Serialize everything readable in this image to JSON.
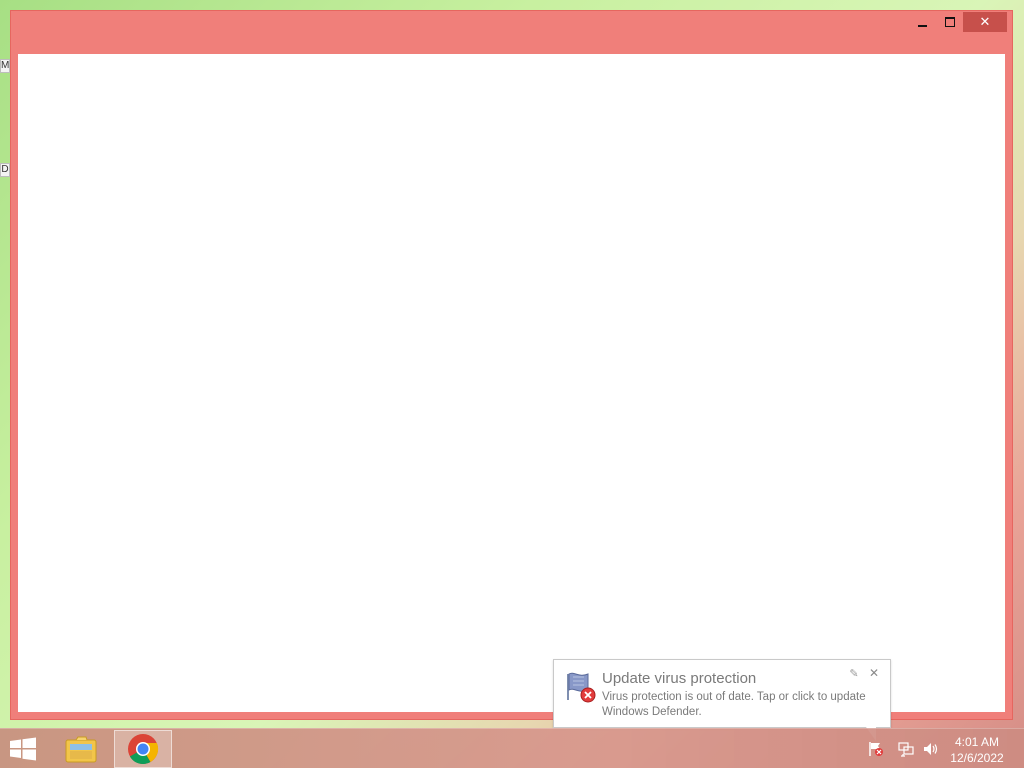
{
  "desktop": {
    "icons": [
      {
        "name": "M"
      },
      {
        "name": "D"
      }
    ]
  },
  "window": {
    "controls": {
      "close_glyph": "✕"
    }
  },
  "notification": {
    "title": "Update virus protection",
    "message": "Virus protection is out of date. Tap or click to update Windows Defender.",
    "options_glyph": "✎",
    "close_glyph": "✕",
    "icon": "windows-defender-flag-icon"
  },
  "taskbar": {
    "start_icon": "windows-logo-icon",
    "apps": [
      {
        "name": "File Explorer",
        "icon": "folder-icon",
        "active": false
      },
      {
        "name": "Google Chrome",
        "icon": "chrome-icon",
        "active": true
      }
    ],
    "tray": {
      "icons": [
        "action-center-flag-icon",
        "network-icon",
        "volume-icon"
      ],
      "time": "4:01 AM",
      "date": "12/6/2022"
    }
  },
  "colors": {
    "window_frame": "#f07f7a",
    "close_button": "#c7504b",
    "content": "#ffffff"
  }
}
